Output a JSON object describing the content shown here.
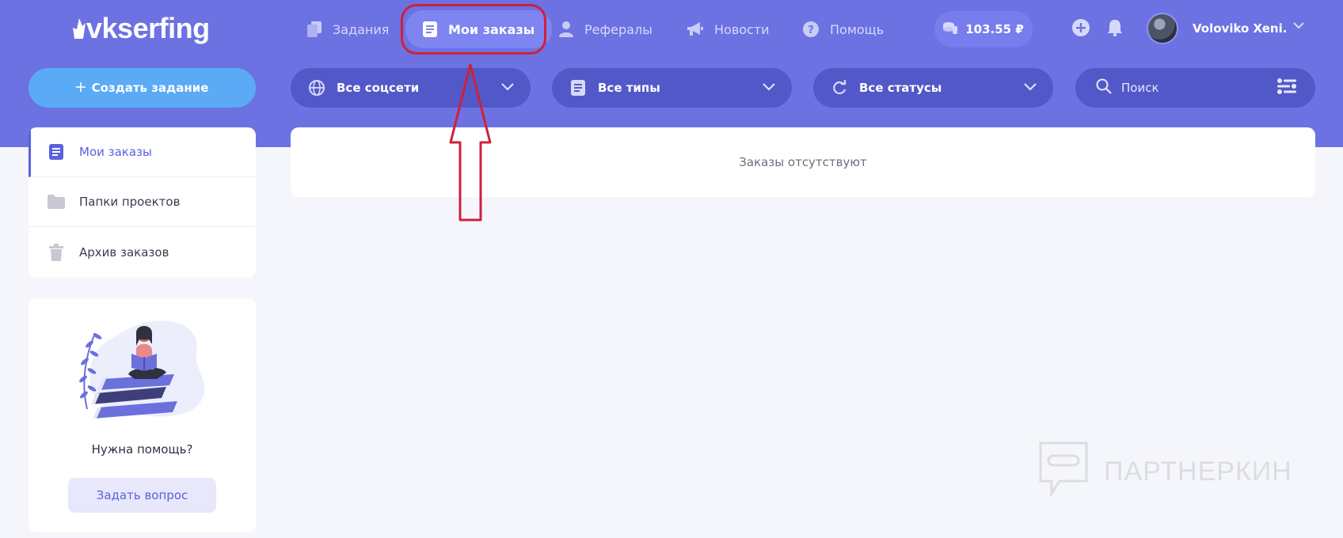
{
  "header": {
    "logo": "vkserfing",
    "nav": [
      {
        "label": "Задания",
        "icon": "copy-icon"
      },
      {
        "label": "Мои заказы",
        "icon": "document-icon",
        "active": true
      },
      {
        "label": "Рефералы",
        "icon": "user-icon"
      },
      {
        "label": "Новости",
        "icon": "megaphone-icon"
      },
      {
        "label": "Помощь",
        "icon": "question-icon"
      }
    ],
    "balance": "103.55 ₽",
    "user_name": "Voloviko Xeni..."
  },
  "toolbar": {
    "create_label": "Создать задание",
    "filters": [
      {
        "label": "Все соцсети",
        "icon": "globe-icon"
      },
      {
        "label": "Все типы",
        "icon": "document-icon"
      },
      {
        "label": "Все статусы",
        "icon": "refresh-icon"
      }
    ],
    "search_placeholder": "Поиск"
  },
  "sidebar": {
    "items": [
      {
        "label": "Мои заказы",
        "icon": "document-icon",
        "active": true
      },
      {
        "label": "Папки проектов",
        "icon": "folder-icon"
      },
      {
        "label": "Архив заказов",
        "icon": "trash-icon"
      }
    ],
    "help": {
      "title": "Нужна помощь?",
      "button": "Задать вопрос"
    }
  },
  "main": {
    "empty_text": "Заказы отсутствуют"
  },
  "watermark": "ПАРТНЕРКИН",
  "colors": {
    "header_bg": "#6c72e2",
    "accent": "#5b61dc",
    "create_button": "#5aaaf6",
    "highlight": "#d0203a"
  }
}
